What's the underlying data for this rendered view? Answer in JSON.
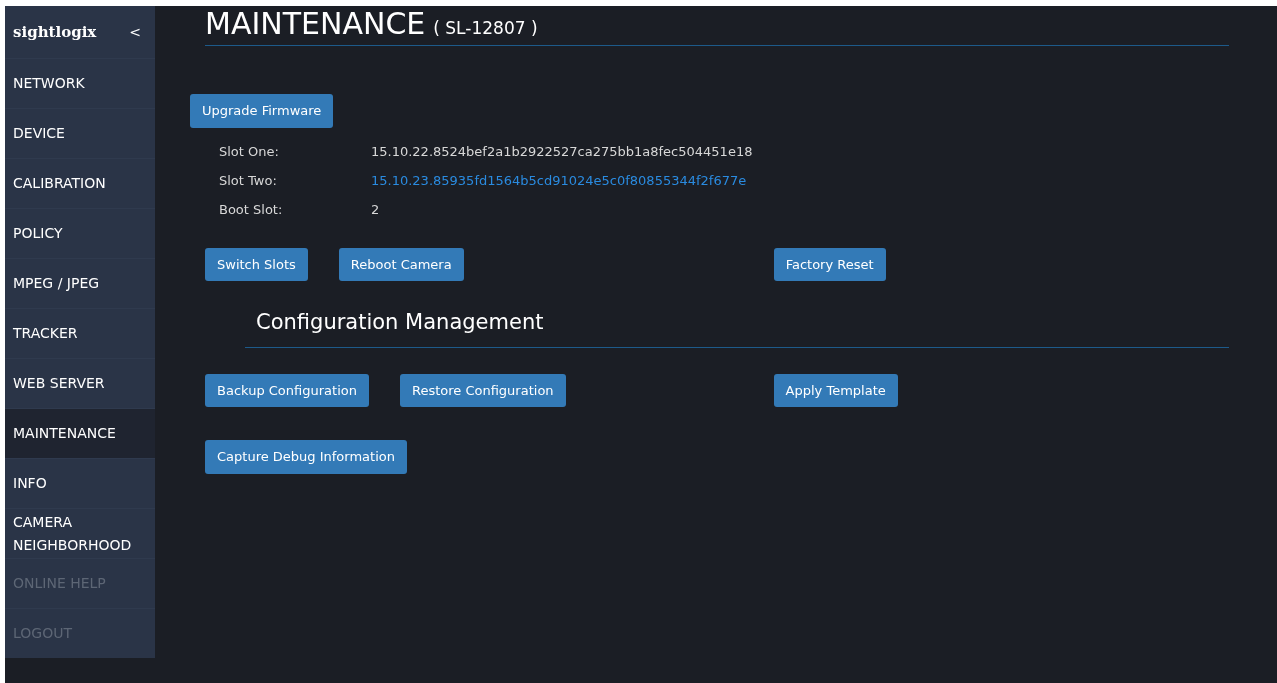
{
  "brand": {
    "logo": "sightlogix",
    "collapse": "<"
  },
  "sidebar": {
    "items": [
      {
        "label": "NETWORK",
        "selected": false,
        "disabled": false
      },
      {
        "label": "DEVICE",
        "selected": false,
        "disabled": false
      },
      {
        "label": "CALIBRATION",
        "selected": false,
        "disabled": false
      },
      {
        "label": "POLICY",
        "selected": false,
        "disabled": false
      },
      {
        "label": "MPEG / JPEG",
        "selected": false,
        "disabled": false
      },
      {
        "label": "TRACKER",
        "selected": false,
        "disabled": false
      },
      {
        "label": "WEB SERVER",
        "selected": false,
        "disabled": false
      },
      {
        "label": "MAINTENANCE",
        "selected": true,
        "disabled": false
      },
      {
        "label": "INFO",
        "selected": false,
        "disabled": false
      },
      {
        "label": "CAMERA NEIGHBORHOOD",
        "selected": false,
        "disabled": false
      },
      {
        "label": "ONLINE HELP",
        "selected": false,
        "disabled": true
      },
      {
        "label": "LOGOUT",
        "selected": false,
        "disabled": true
      }
    ]
  },
  "page": {
    "title": "MAINTENANCE",
    "subtitle": "( SL-12807 )"
  },
  "firmware": {
    "upgrade_button": "Upgrade Firmware",
    "slots": [
      {
        "label": "Slot One:",
        "value": "15.10.22.8524bef2a1b2922527ca275bb1a8fec504451e18",
        "active": false
      },
      {
        "label": "Slot Two:",
        "value": "15.10.23.85935fd1564b5cd91024e5c0f80855344f2f677e",
        "active": true
      },
      {
        "label": "Boot Slot:",
        "value": "2",
        "active": false
      }
    ],
    "buttons": [
      "Switch Slots",
      "Reboot Camera"
    ],
    "reset_button": "Factory Reset"
  },
  "configuration": {
    "heading": "Configuration Management",
    "buttons": [
      "Backup Configuration",
      "Restore Configuration"
    ],
    "template_button": "Apply Template",
    "debug_button": "Capture Debug Information"
  }
}
